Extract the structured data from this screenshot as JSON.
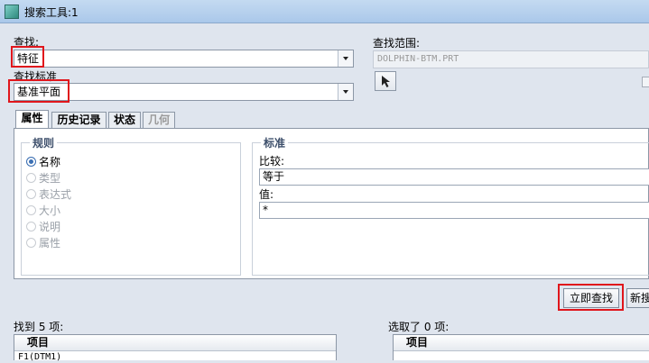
{
  "window": {
    "title": "搜索工具:1"
  },
  "find": {
    "type_label": "查找:",
    "type_value": "特征",
    "criteria_label": "查找标准",
    "criteria_value": "基准平面"
  },
  "scope": {
    "label": "查找范围:",
    "value": "DOLPHIN-BTM.PRT"
  },
  "tabs": [
    {
      "label": "属性",
      "active": true
    },
    {
      "label": "历史记录",
      "active": false
    },
    {
      "label": "状态",
      "active": false
    },
    {
      "label": "几何",
      "active": false,
      "disabled": true
    }
  ],
  "rules": {
    "title": "规则",
    "items": [
      {
        "label": "名称",
        "selected": true,
        "enabled": true
      },
      {
        "label": "类型",
        "selected": false,
        "enabled": false
      },
      {
        "label": "表达式",
        "selected": false,
        "enabled": false
      },
      {
        "label": "大小",
        "selected": false,
        "enabled": false
      },
      {
        "label": "说明",
        "selected": false,
        "enabled": false
      },
      {
        "label": "属性",
        "selected": false,
        "enabled": false
      }
    ]
  },
  "criteria": {
    "title": "标准",
    "compare_label": "比较:",
    "compare_value": "等于",
    "value_label": "值:",
    "value_value": "*"
  },
  "buttons": {
    "find_now": "立即查找",
    "new_search": "新搜"
  },
  "results": {
    "found_label": "找到 5 项:",
    "selected_label": "选取了 0 项:",
    "column_header": "项目",
    "first_item": "F1(DTM1)"
  },
  "colors": {
    "highlight": "#e0161c"
  }
}
